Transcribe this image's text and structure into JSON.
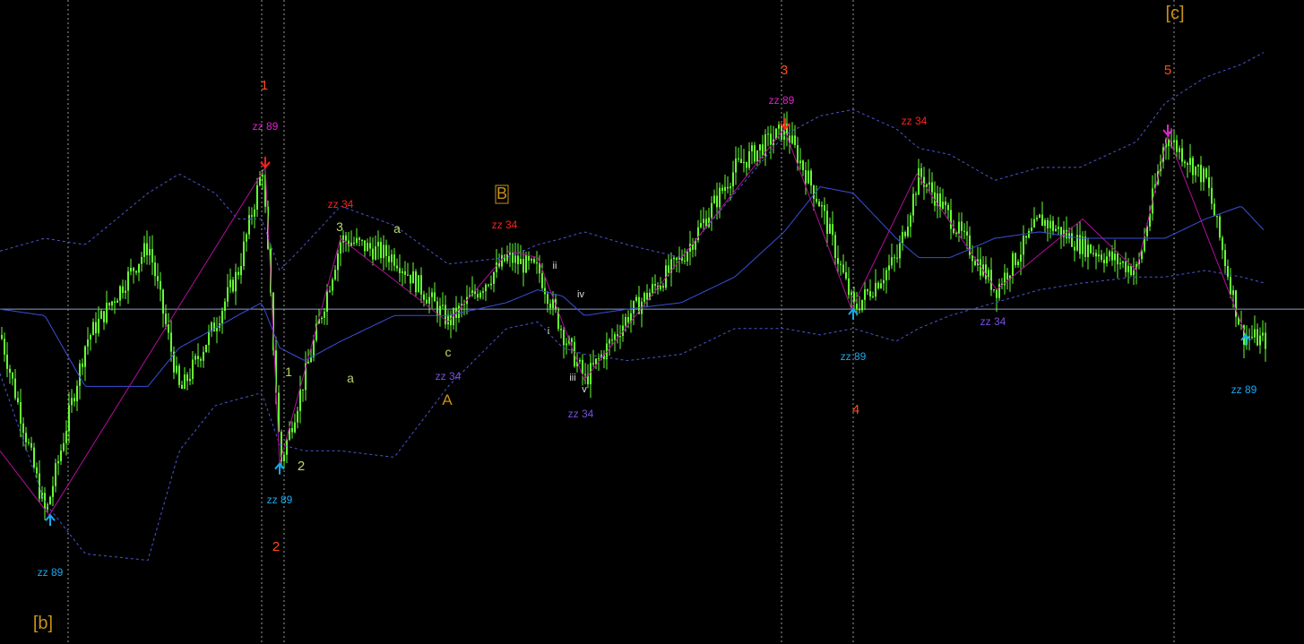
{
  "chart_data": {
    "type": "line",
    "title": "",
    "background": "#000000",
    "colors": {
      "candle": "#66ff33",
      "bollinger": "#4a56d4",
      "ma": "#3a4fd8",
      "zigzag": "#b0109a",
      "hline": "#8aa0c8",
      "vline": "#9a9a9a",
      "red": "#ff2020",
      "magenta": "#e020d0",
      "cyan": "#18a8f0",
      "purple": "#7a4ee0",
      "gold": "#c8901a",
      "wave_green": "#b8d868",
      "orange_red": "#ff4a1a",
      "white": "#dddddd"
    },
    "ylim": [
      0,
      100
    ],
    "x": [
      0,
      50,
      95,
      165,
      200,
      240,
      265,
      292,
      312,
      340,
      380,
      440,
      500,
      565,
      600,
      628,
      652,
      700,
      760,
      820,
      875,
      915,
      952,
      1000,
      1025,
      1060,
      1110,
      1160,
      1205,
      1268,
      1300,
      1345,
      1385,
      1412
    ],
    "price": [
      48,
      20,
      47,
      62,
      39,
      50,
      58,
      74,
      28,
      42,
      63,
      60,
      50,
      60,
      58,
      48,
      41,
      51,
      60,
      74,
      80,
      68,
      52,
      60,
      73,
      66,
      55,
      66,
      62,
      58,
      79,
      72,
      48,
      47
    ],
    "bb_upper": [
      61,
      63,
      62,
      70,
      73,
      70,
      66,
      66,
      58,
      62,
      68,
      65,
      59,
      60,
      62,
      63,
      64,
      62,
      60,
      70,
      79,
      82,
      83,
      80,
      77,
      76,
      72,
      74,
      74,
      78,
      84,
      88,
      90,
      92
    ],
    "bb_lower": [
      42,
      22,
      14,
      13,
      30,
      37,
      38,
      39,
      31,
      30,
      30,
      29,
      40,
      49,
      50,
      46,
      45,
      44,
      45,
      49,
      49,
      48,
      49,
      47,
      49,
      51,
      53,
      55,
      56,
      57,
      57,
      58,
      57,
      56
    ],
    "ma": [
      52,
      51,
      40,
      40,
      46,
      49,
      51,
      53,
      46,
      44,
      47,
      51,
      51,
      53,
      55,
      54,
      51,
      52,
      53,
      57,
      64,
      71,
      70,
      63,
      60,
      60,
      63,
      64,
      63,
      63,
      63,
      66,
      68,
      64
    ],
    "zigzag_x": [
      0,
      55,
      296,
      312,
      380,
      500,
      568,
      600,
      652,
      875,
      950,
      1023,
      1112,
      1208,
      1268,
      1303,
      1390
    ],
    "zigzag_y": [
      30,
      20,
      74,
      28,
      63,
      50,
      61,
      60,
      41,
      80,
      52,
      73,
      55,
      66,
      58,
      79,
      48
    ],
    "horizontal_line": 52,
    "vertical_lines_x": [
      76,
      292,
      317,
      872,
      952,
      1310
    ]
  },
  "markers": [
    {
      "x": 296,
      "y": 74,
      "symbol": "arrow-down",
      "color": "red"
    },
    {
      "x": 876,
      "y": 80,
      "symbol": "arrow-down",
      "color": "red"
    },
    {
      "x": 1303,
      "y": 79,
      "symbol": "arrow-down",
      "color": "magenta"
    },
    {
      "x": 56,
      "y": 20,
      "symbol": "arrow-up",
      "color": "cyan"
    },
    {
      "x": 312,
      "y": 28,
      "symbol": "arrow-up",
      "color": "cyan"
    },
    {
      "x": 952,
      "y": 52,
      "symbol": "arrow-up",
      "color": "cyan"
    },
    {
      "x": 1390,
      "y": 48,
      "symbol": "arrow-up",
      "color": "cyan"
    }
  ],
  "labels": [
    {
      "text": "1",
      "x": 295,
      "y": 100,
      "color": "orange_red",
      "size": 15
    },
    {
      "text": "zz 89",
      "x": 296,
      "y": 145,
      "color": "magenta",
      "size": 12
    },
    {
      "text": "zz 34",
      "x": 380,
      "y": 232,
      "color": "red",
      "size": 12
    },
    {
      "text": "3",
      "x": 379,
      "y": 258,
      "color": "wave_green",
      "size": 14
    },
    {
      "text": "a",
      "x": 443,
      "y": 260,
      "color": "wave_green",
      "size": 14
    },
    {
      "text": "B",
      "x": 560,
      "y": 222,
      "color": "gold",
      "size": 18,
      "boxed": true
    },
    {
      "text": "zz 34",
      "x": 563,
      "y": 255,
      "color": "red",
      "size": 12
    },
    {
      "text": "ii",
      "x": 619,
      "y": 300,
      "color": "white",
      "size": 11
    },
    {
      "text": "iv",
      "x": 648,
      "y": 332,
      "color": "white",
      "size": 11
    },
    {
      "text": "i",
      "x": 612,
      "y": 373,
      "color": "white",
      "size": 11
    },
    {
      "text": "c",
      "x": 500,
      "y": 398,
      "color": "wave_green",
      "size": 14
    },
    {
      "text": "1",
      "x": 322,
      "y": 420,
      "color": "wave_green",
      "size": 14
    },
    {
      "text": "a",
      "x": 391,
      "y": 427,
      "color": "wave_green",
      "size": 14
    },
    {
      "text": "zz 34",
      "x": 500,
      "y": 424,
      "color": "purple",
      "size": 12
    },
    {
      "text": "iii",
      "x": 639,
      "y": 425,
      "color": "white",
      "size": 11
    },
    {
      "text": "v",
      "x": 652,
      "y": 438,
      "color": "white",
      "size": 11
    },
    {
      "text": "A",
      "x": 499,
      "y": 452,
      "color": "gold",
      "size": 17
    },
    {
      "text": "zz 34",
      "x": 648,
      "y": 466,
      "color": "purple",
      "size": 12
    },
    {
      "text": "2",
      "x": 336,
      "y": 525,
      "color": "wave_green",
      "size": 15
    },
    {
      "text": "zz 89",
      "x": 312,
      "y": 562,
      "color": "cyan",
      "size": 12
    },
    {
      "text": "2",
      "x": 308,
      "y": 615,
      "color": "orange_red",
      "size": 15
    },
    {
      "text": "zz 89",
      "x": 56,
      "y": 643,
      "color": "cyan",
      "size": 12
    },
    {
      "text": "[b]",
      "x": 48,
      "y": 702,
      "color": "gold",
      "size": 20
    },
    {
      "text": "3",
      "x": 875,
      "y": 83,
      "color": "orange_red",
      "size": 15
    },
    {
      "text": "zz 89",
      "x": 872,
      "y": 116,
      "color": "magenta",
      "size": 12
    },
    {
      "text": "zz 34",
      "x": 1020,
      "y": 139,
      "color": "red",
      "size": 12
    },
    {
      "text": "zz 34",
      "x": 1108,
      "y": 363,
      "color": "purple",
      "size": 12
    },
    {
      "text": "zz 89",
      "x": 952,
      "y": 402,
      "color": "cyan",
      "size": 12
    },
    {
      "text": "4",
      "x": 955,
      "y": 462,
      "color": "orange_red",
      "size": 15
    },
    {
      "text": "[c]",
      "x": 1311,
      "y": 21,
      "color": "gold",
      "size": 20
    },
    {
      "text": "5",
      "x": 1303,
      "y": 83,
      "color": "orange_red",
      "size": 15
    },
    {
      "text": "zz 89",
      "x": 1388,
      "y": 439,
      "color": "cyan",
      "size": 12
    }
  ]
}
